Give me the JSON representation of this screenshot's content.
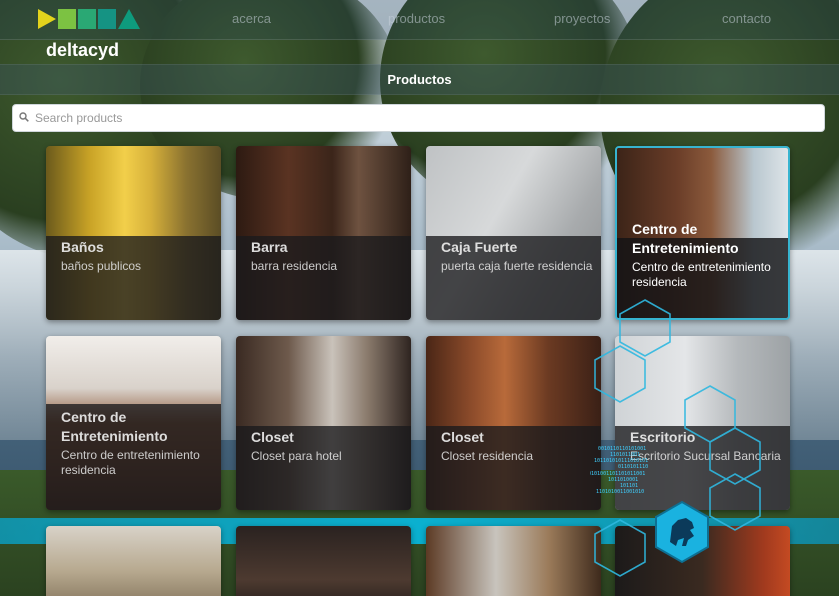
{
  "brand": "deltacyd",
  "nav": {
    "items": [
      "acerca",
      "productos",
      "proyectos",
      "contacto"
    ]
  },
  "section": {
    "title": "Productos"
  },
  "search": {
    "placeholder": "Search products",
    "value": ""
  },
  "products": [
    {
      "title": "Baños",
      "desc": "baños publicos"
    },
    {
      "title": "Barra",
      "desc": "barra residencia"
    },
    {
      "title": "Caja Fuerte",
      "desc": "puerta caja fuerte residencia"
    },
    {
      "title": "Centro de Entretenimiento",
      "desc": "Centro de entretenimiento residencia"
    },
    {
      "title": "Centro de Entretenimiento",
      "desc": "Centro de entretenimiento residencia"
    },
    {
      "title": "Closet",
      "desc": "Closet para hotel"
    },
    {
      "title": "Closet",
      "desc": "Closet residencia"
    },
    {
      "title": "Escritorio",
      "desc": "Escritorio Sucursal Bancaria"
    }
  ],
  "colors": {
    "accent": "#37b4d0",
    "logo_yellow": "#e3d31c",
    "logo_green": "#7cc242",
    "logo_teal": "#0e9b7d"
  }
}
